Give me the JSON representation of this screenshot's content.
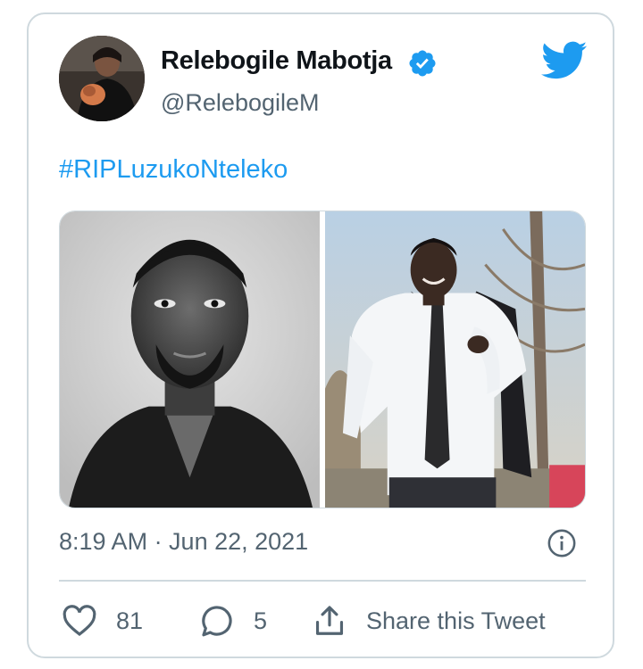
{
  "tweet": {
    "author": {
      "display_name": "Relebogile Mabotja",
      "handle": "@RelebogileM",
      "verified": true,
      "avatar_icon": "avatar-photo"
    },
    "brand_icon": "twitter-bird-icon",
    "text": "#RIPLuzukoNteleko",
    "media": [
      {
        "description_icon": "bw-portrait-photo"
      },
      {
        "description_icon": "outdoor-suit-photo"
      }
    ],
    "timestamp": "8:19 AM · Jun 22, 2021",
    "actions": {
      "like_count": "81",
      "reply_count": "5",
      "share_label": "Share this Tweet"
    }
  },
  "colors": {
    "accent": "#1d9bf0",
    "muted_text": "#536471",
    "border": "#cfd9de",
    "text": "#0f1419"
  }
}
